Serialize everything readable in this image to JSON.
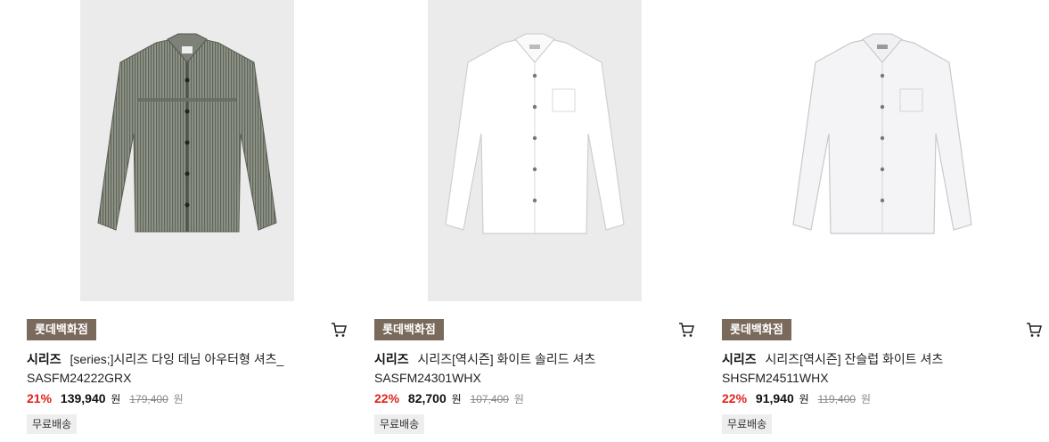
{
  "products": [
    {
      "store": "롯데백화점",
      "brand": "시리즈",
      "name": "[series;]시리즈 다잉 데님 아우터형 셔츠_",
      "code": "SASFM24222GRX",
      "discount": "21%",
      "sale_price": "139,940",
      "currency": "원",
      "original_price": "179,400",
      "shipping": "무료배송",
      "image_icon": "gray-denim-shirt-icon",
      "cart_icon": "cart-icon"
    },
    {
      "store": "롯데백화점",
      "brand": "시리즈",
      "name": "시리즈[역시즌] 화이트 솔리드 셔츠",
      "code": "SASFM24301WHX",
      "discount": "22%",
      "sale_price": "82,700",
      "currency": "원",
      "original_price": "107,400",
      "shipping": "무료배송",
      "image_icon": "white-solid-shirt-icon",
      "cart_icon": "cart-icon"
    },
    {
      "store": "롯데백화점",
      "brand": "시리즈",
      "name": "시리즈[역시즌] 잔슬럽 화이트 셔츠",
      "code": "SHSFM24511WHX",
      "discount": "22%",
      "sale_price": "91,940",
      "currency": "원",
      "original_price": "119,400",
      "shipping": "무료배송",
      "image_icon": "white-slub-shirt-icon",
      "cart_icon": "cart-icon"
    }
  ],
  "colors": {
    "store_badge": "#7a6a5c",
    "discount": "#e0221c",
    "image_bg": "#ebebeb"
  }
}
